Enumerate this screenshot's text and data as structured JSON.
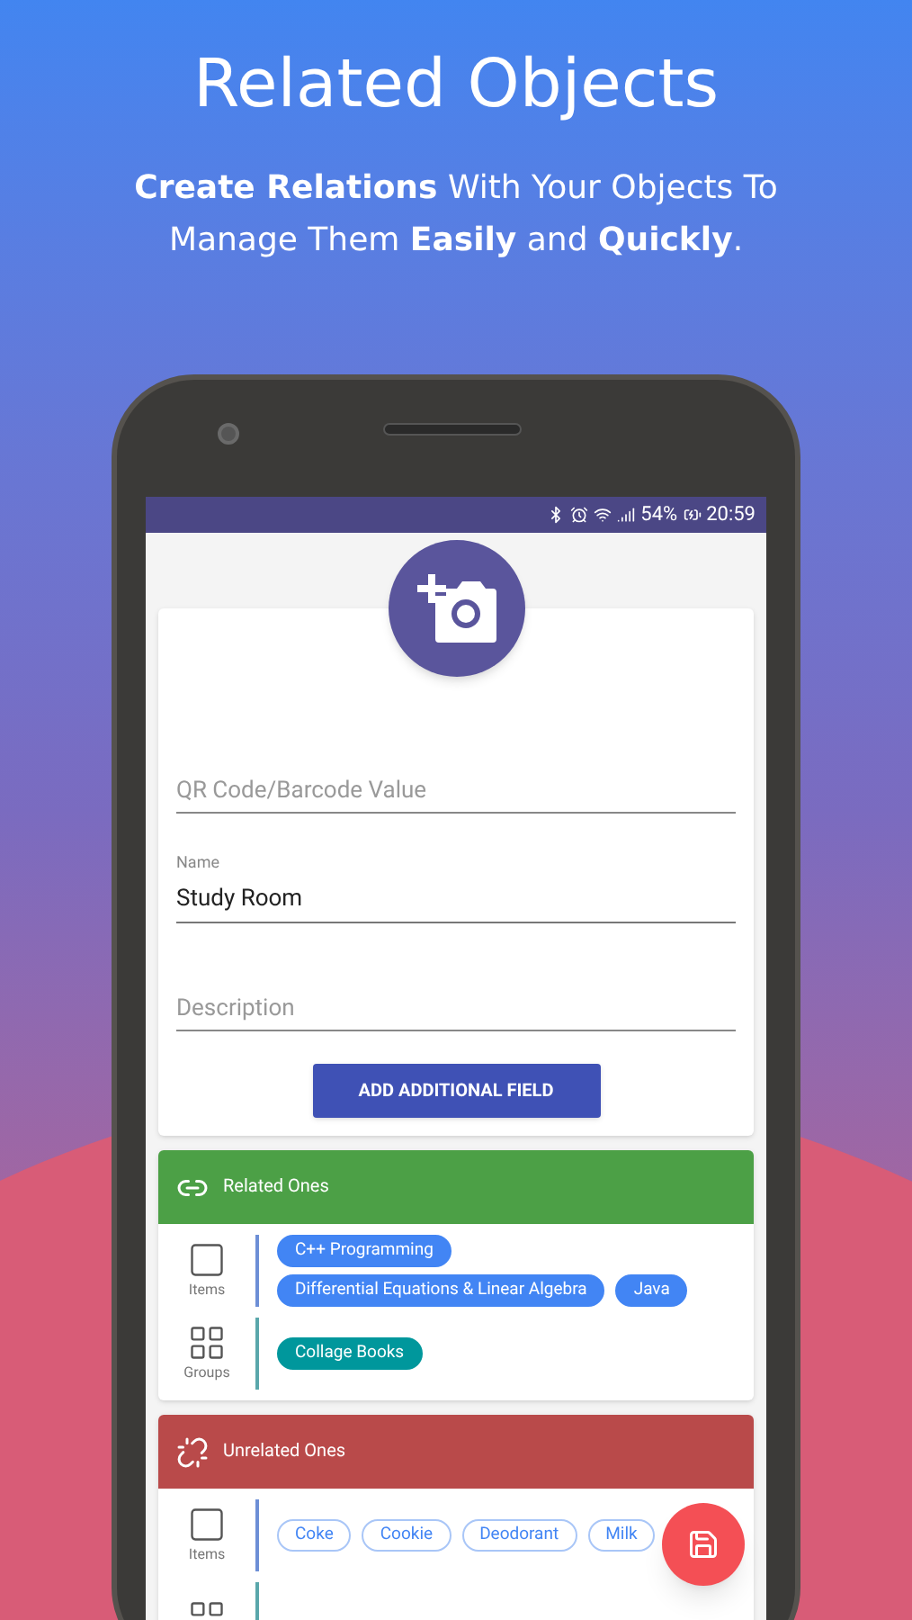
{
  "header": {
    "title": "Related Objects",
    "subtitle": "**Create Relations** With Your Objects To Manage Them **Easily** and **Quickly**."
  },
  "status_bar": {
    "battery": "54%",
    "time": "20:59"
  },
  "form": {
    "fields": [
      {
        "placeholder": "QR Code/Barcode Value"
      },
      {
        "label": "Name",
        "value": "Study Room"
      },
      {
        "placeholder": "Description"
      }
    ],
    "button": "ADD ADDITIONAL FIELD"
  },
  "sections": [
    {
      "kind": "related",
      "title": "Related Ones",
      "rows": [
        {
          "kind": "items",
          "label": "Items",
          "chips": [
            "C++ Programming",
            "Differential Equations & Linear Algebra",
            "Java"
          ]
        },
        {
          "kind": "groups",
          "label": "Groups",
          "chips": [
            "Collage Books"
          ]
        }
      ]
    },
    {
      "kind": "unrelated",
      "title": "Unrelated Ones",
      "rows": [
        {
          "kind": "items",
          "label": "Items",
          "chips": [
            "Coke",
            "Cookie",
            "Deodorant",
            "Milk"
          ]
        },
        {
          "kind": "groups"
        }
      ]
    }
  ]
}
